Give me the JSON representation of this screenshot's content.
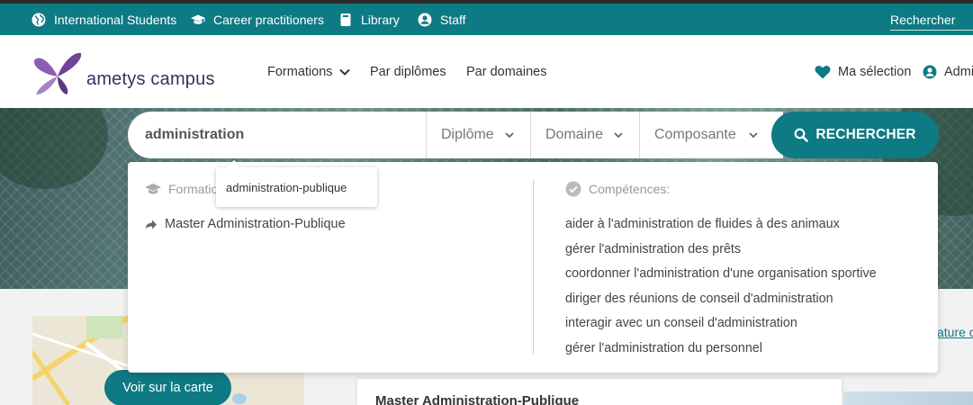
{
  "topbar": {
    "links": [
      {
        "label": "International Students",
        "icon": "globe-icon"
      },
      {
        "label": "Career practitioners",
        "icon": "graduation-cap-icon"
      },
      {
        "label": "Library",
        "icon": "book-icon"
      },
      {
        "label": "Staff",
        "icon": "user-icon"
      }
    ],
    "search_label": "Rechercher"
  },
  "header": {
    "logo_text": "ametys campus",
    "nav": [
      {
        "label": "Formations",
        "has_dropdown": true
      },
      {
        "label": "Par diplômes"
      },
      {
        "label": "Par domaines"
      }
    ],
    "selection_label": "Ma sélection",
    "account_label": "Admi"
  },
  "search": {
    "query": "administration",
    "diplome_label": "Diplôme",
    "domaine_label": "Domaine",
    "composante_label": "Composante",
    "button_label": "RECHERCHER"
  },
  "suggestions": {
    "formations_heading": "Formations",
    "formations": [
      "Master Administration-Publique"
    ],
    "competences_heading": "Compétences:",
    "competences": [
      "aider à l'administration de fluides à des animaux",
      "gérer l'administration des prêts",
      "coordonner l'administration d'une organisation sportive",
      "diriger des réunions de conseil d'administration",
      "interagir avec un conseil d'administration",
      "gérer l'administration du personnel"
    ],
    "tooltip": "administration-publique"
  },
  "page": {
    "map_button_label": "Voir sur la carte",
    "result_title": "Master Administration-Publique",
    "side_link": "ature c"
  },
  "colors": {
    "accent": "#0e7a83",
    "logo": "#7b4fa0"
  }
}
